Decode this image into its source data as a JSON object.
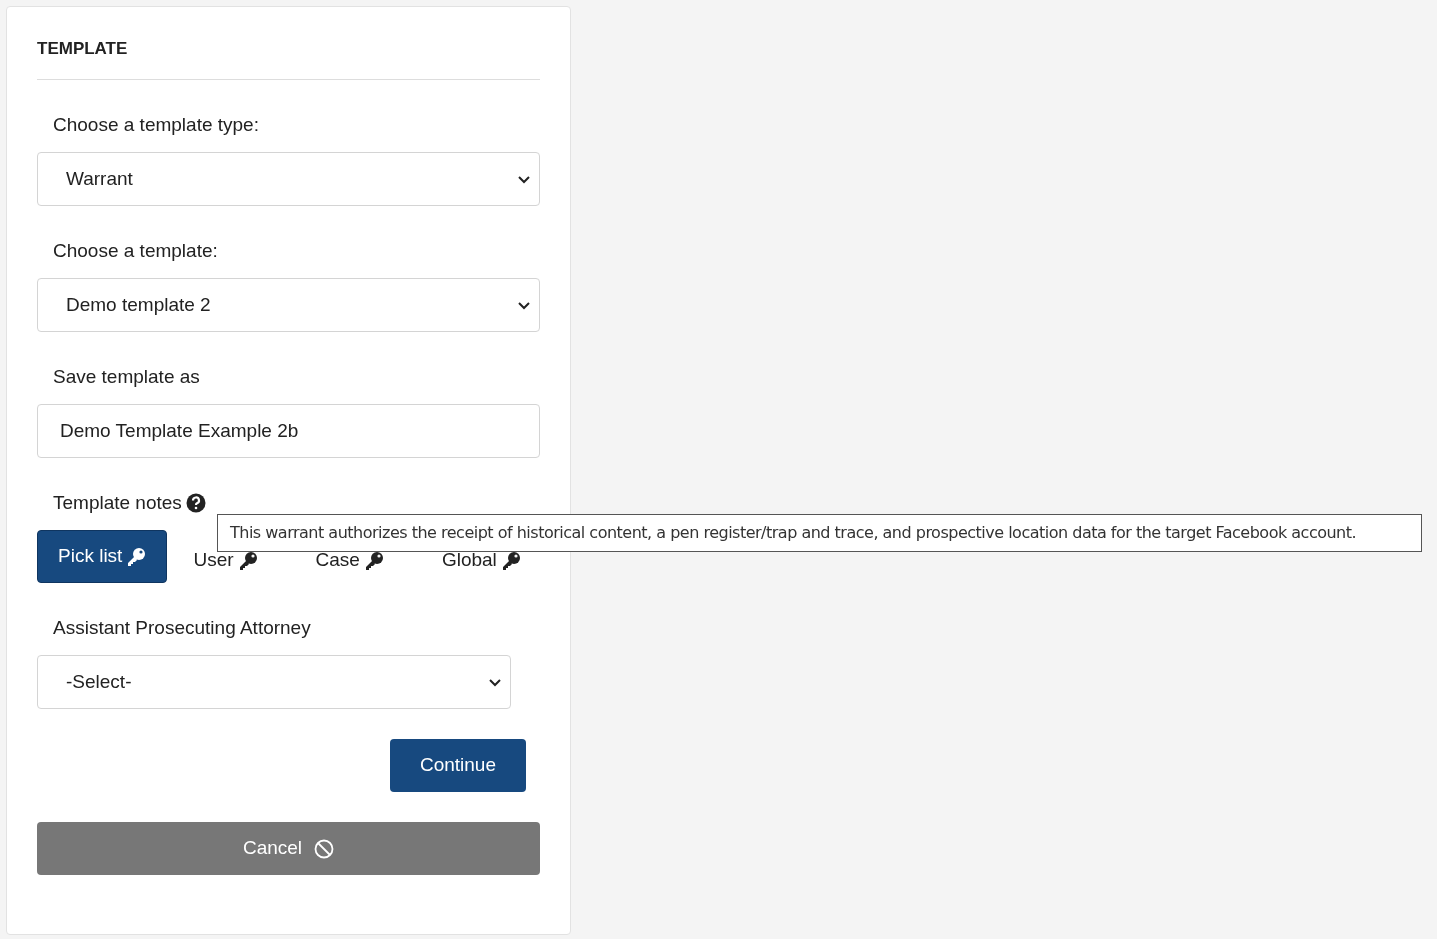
{
  "panel": {
    "title": "TEMPLATE"
  },
  "template_type": {
    "label": "Choose a template type:",
    "value": "Warrant"
  },
  "template": {
    "label": "Choose a template:",
    "value": "Demo template 2"
  },
  "save_as": {
    "label": "Save template as",
    "value": "Demo Template Example 2b"
  },
  "notes": {
    "label": "Template notes",
    "tooltip": "This warrant authorizes the receipt of historical content, a pen register/trap and trace, and prospective location data for the target Facebook account."
  },
  "tabs": [
    {
      "label": "Pick list",
      "selected": true
    },
    {
      "label": "User",
      "selected": false
    },
    {
      "label": "Case",
      "selected": false
    },
    {
      "label": "Global",
      "selected": false
    }
  ],
  "attorney": {
    "label": "Assistant Prosecuting Attorney",
    "value": "-Select-"
  },
  "buttons": {
    "continue": "Continue",
    "cancel": "Cancel"
  }
}
